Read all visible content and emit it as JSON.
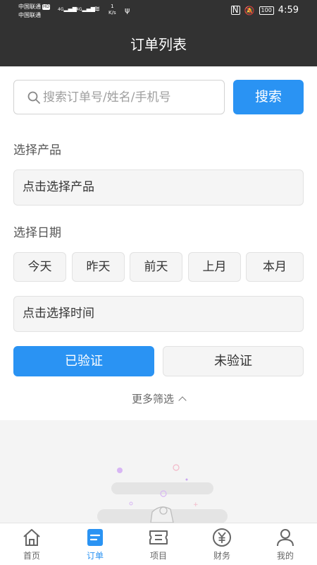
{
  "status_bar": {
    "carrier1": "中国联通",
    "carrier2": "中国联通",
    "hd": "HD",
    "net1": "4G",
    "net2": "4G",
    "speed_value": "1",
    "speed_unit": "K/s",
    "battery": "100",
    "time": "4:59"
  },
  "header": {
    "title": "订单列表"
  },
  "search": {
    "placeholder": "搜索订单号/姓名/手机号",
    "value": "",
    "button_label": "搜索"
  },
  "product": {
    "label": "选择产品",
    "placeholder": "点击选择产品"
  },
  "date": {
    "label": "选择日期",
    "quick_options": [
      "今天",
      "昨天",
      "前天",
      "上月",
      "本月"
    ],
    "placeholder": "点击选择时间"
  },
  "verify": {
    "verified_label": "已验证",
    "unverified_label": "未验证",
    "selected": "已验证"
  },
  "more_filters": "更多筛选",
  "tabbar": {
    "items": [
      {
        "label": "首页",
        "icon": "home-icon"
      },
      {
        "label": "订单",
        "icon": "order-icon"
      },
      {
        "label": "项目",
        "icon": "ticket-icon"
      },
      {
        "label": "财务",
        "icon": "yen-icon"
      },
      {
        "label": "我的",
        "icon": "user-icon"
      }
    ],
    "active_index": 1
  },
  "colors": {
    "accent": "#2a93f3",
    "header_bg": "#323232",
    "field_bg": "#f5f5f5"
  }
}
